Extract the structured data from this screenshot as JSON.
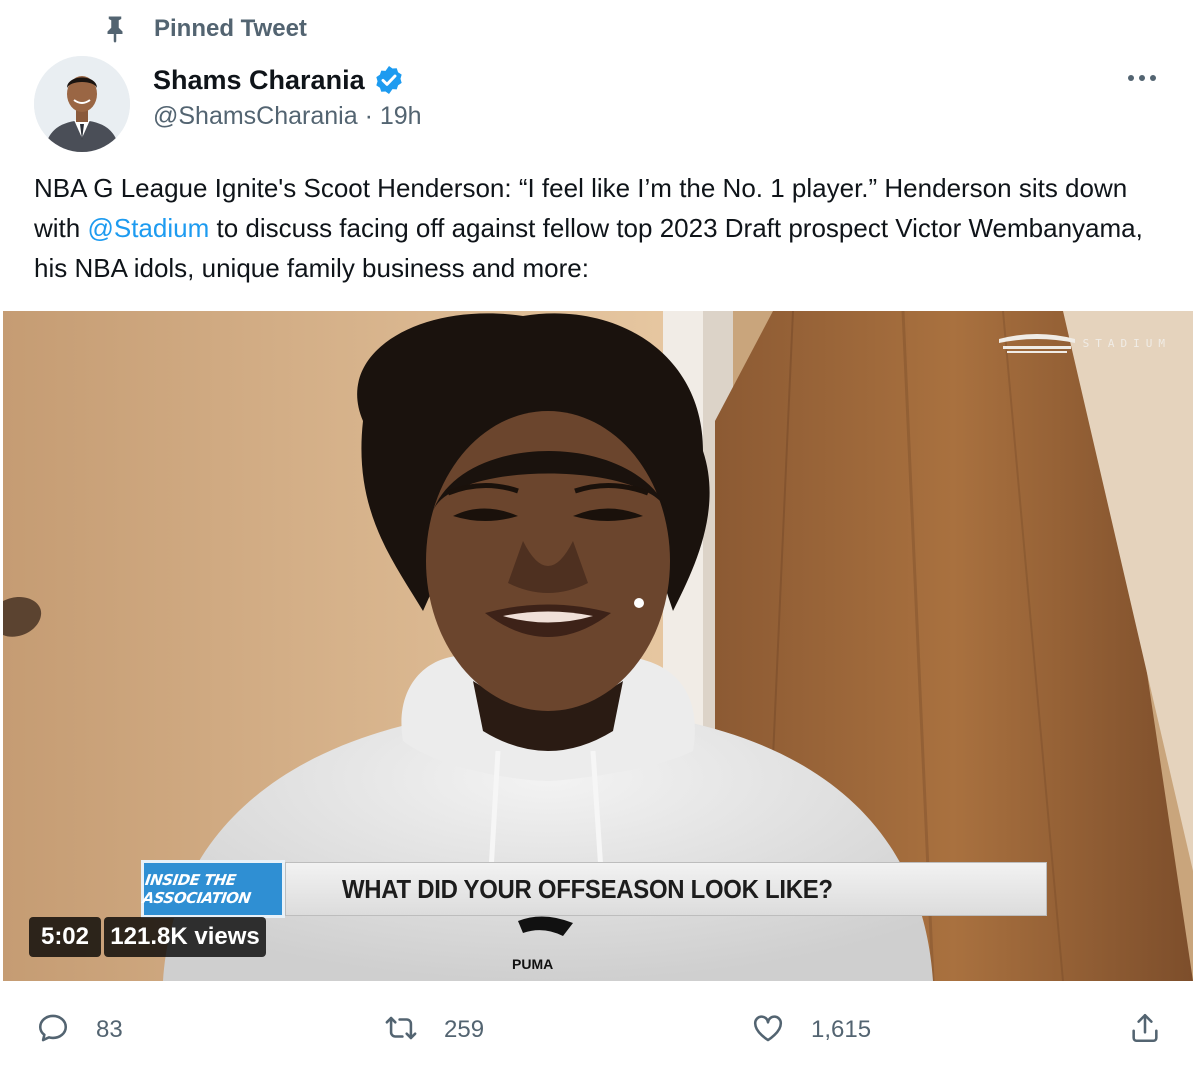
{
  "pinned": {
    "label": "Pinned Tweet",
    "icon": "pin-icon"
  },
  "author": {
    "name": "Shams Charania",
    "handle": "@ShamsCharania",
    "separator": "·",
    "time": "19h",
    "verified_icon": "verified-badge-icon",
    "verified_color": "#1d9bf0"
  },
  "menu": {
    "icon": "more-options-icon"
  },
  "tweet": {
    "text_before": "NBA G League Ignite's Scoot Henderson: “I feel like I’m the No. 1 player.” Henderson sits down with ",
    "mention": "@Stadium",
    "text_after": " to discuss facing off against fellow top 2023 Draft prospect Victor Wembanyama, his NBA idols, unique family business and more:"
  },
  "video": {
    "watermark": "STADIUM",
    "lower_third_badge": "INSIDE THE ASSOCIATION",
    "lower_third_question": "WHAT DID YOUR OFFSEASON LOOK LIKE?",
    "duration": "5:02",
    "views": "121.8K views",
    "shirt_logo": "PUMA"
  },
  "actions": {
    "replies": "83",
    "retweets": "259",
    "likes": "1,615"
  },
  "colors": {
    "text_primary": "#0f1419",
    "text_secondary": "#536471",
    "link": "#1d9bf0"
  }
}
